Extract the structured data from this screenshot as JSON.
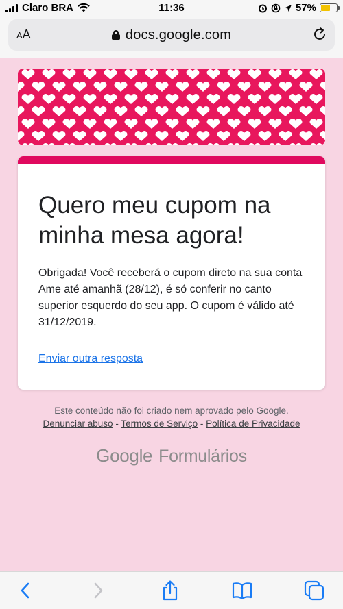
{
  "status_bar": {
    "carrier": "Claro BRA",
    "time": "11:36",
    "battery_percent": "57%"
  },
  "browser": {
    "text_size_label": "AA",
    "url": "docs.google.com"
  },
  "form": {
    "title": "Quero meu cupom na minha mesa agora!",
    "confirmation_message": "Obrigada! Você receberá o cupom direto na sua conta Ame até amanhã (28/12), é só conferir no canto superior esquerdo do seu app. O cupom é válido até 31/12/2019.",
    "submit_another_link": "Enviar outra resposta"
  },
  "footer": {
    "disclaimer": "Este conteúdo não foi criado nem aprovado pelo Google.",
    "report_abuse": "Denunciar abuso",
    "terms": "Termos de Serviço",
    "privacy": "Política de Privacidade",
    "separator": "-",
    "brand_google": "Google",
    "brand_product": "Formulários"
  },
  "colors": {
    "page_background": "#f8d5e3",
    "accent": "#e0095e",
    "link": "#1a73e8"
  },
  "icons": {
    "back": "chevron-left-icon",
    "forward": "chevron-right-icon",
    "share": "share-icon",
    "bookmarks": "book-icon",
    "tabs": "tabs-icon"
  }
}
